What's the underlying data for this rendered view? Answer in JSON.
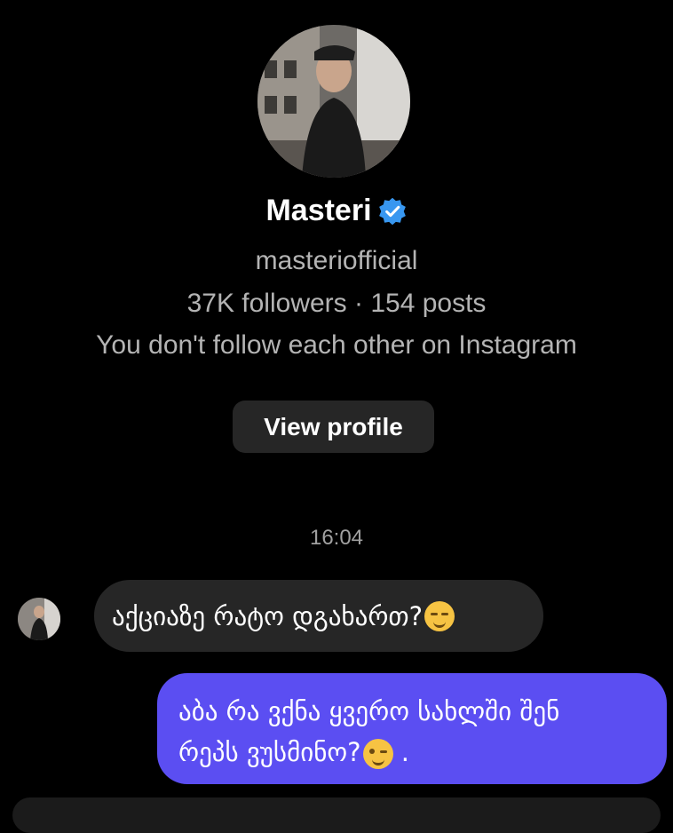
{
  "profile": {
    "display_name": "Masteri",
    "verified": true,
    "username": "masteriofficial",
    "stats": "37K followers · 154 posts",
    "follow_note": "You don't follow each other on Instagram",
    "view_profile_label": "View profile"
  },
  "conversation": {
    "timestamp": "16:04",
    "messages": [
      {
        "direction": "incoming",
        "text": "აქციაზე რატო დგახართ?",
        "emoji": "pensive-face-icon"
      },
      {
        "direction": "outgoing",
        "text_line1": "აბა რა ვქნა ყვერო სახლში შენ",
        "text_line2": "რეპს ვუსმინო?",
        "emoji": "winking-face-icon",
        "trailing": " ."
      }
    ]
  },
  "colors": {
    "background": "#000000",
    "incoming_bubble": "#262626",
    "outgoing_bubble": "#5b4ef2",
    "verified_badge": "#3897f0"
  }
}
